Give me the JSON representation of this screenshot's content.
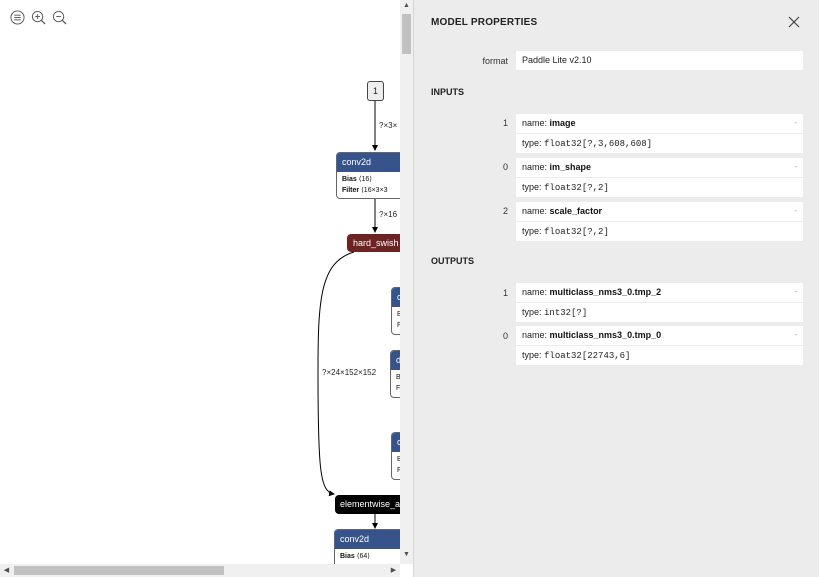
{
  "toolbar": {
    "icons": [
      "menu-icon",
      "zoom-in-icon",
      "zoom-out-icon"
    ]
  },
  "graph": {
    "input_node": "1",
    "edge_labels": [
      "?×3×",
      "?×16",
      "?×24×152×152"
    ],
    "nodes": {
      "conv1": {
        "title": "conv2d",
        "attr1_name": "Bias",
        "attr1_value": "⟨16⟩",
        "attr2_name": "Filter",
        "attr2_value": "⟨16×3×3"
      },
      "hard_swish": "hard_swish",
      "p1": {
        "title": "c",
        "a1": "B",
        "a2": "F"
      },
      "p2": {
        "title": "d",
        "a1": "B",
        "a2": "Fil"
      },
      "p3": {
        "title": "c",
        "a1": "B",
        "a2": "F"
      },
      "elementwise": "elementwise_ac",
      "conv2": {
        "title": "conv2d",
        "attr1_name": "Bias",
        "attr1_value": "⟨64⟩"
      }
    },
    "colors": {
      "layer": "#37538c",
      "activation": "#6e2323",
      "elementwise": "#000000"
    }
  },
  "sidebar": {
    "title": "MODEL PROPERTIES",
    "format_label": "format",
    "format_value": "Paddle Lite v2.10",
    "inputs_heading": "INPUTS",
    "inputs": [
      {
        "index": "1",
        "name_label": "name:",
        "name": "image",
        "type_label": "type:",
        "type": "float32[?,3,608,608]"
      },
      {
        "index": "0",
        "name_label": "name:",
        "name": "im_shape",
        "type_label": "type:",
        "type": "float32[?,2]"
      },
      {
        "index": "2",
        "name_label": "name:",
        "name": "scale_factor",
        "type_label": "type:",
        "type": "float32[?,2]"
      }
    ],
    "outputs_heading": "OUTPUTS",
    "outputs": [
      {
        "index": "1",
        "name_label": "name:",
        "name": "multiclass_nms3_0.tmp_2",
        "type_label": "type:",
        "type": "int32[?]"
      },
      {
        "index": "0",
        "name_label": "name:",
        "name": "multiclass_nms3_0.tmp_0",
        "type_label": "type:",
        "type": "float32[22743,6]"
      }
    ],
    "expand_symbol": "-"
  }
}
